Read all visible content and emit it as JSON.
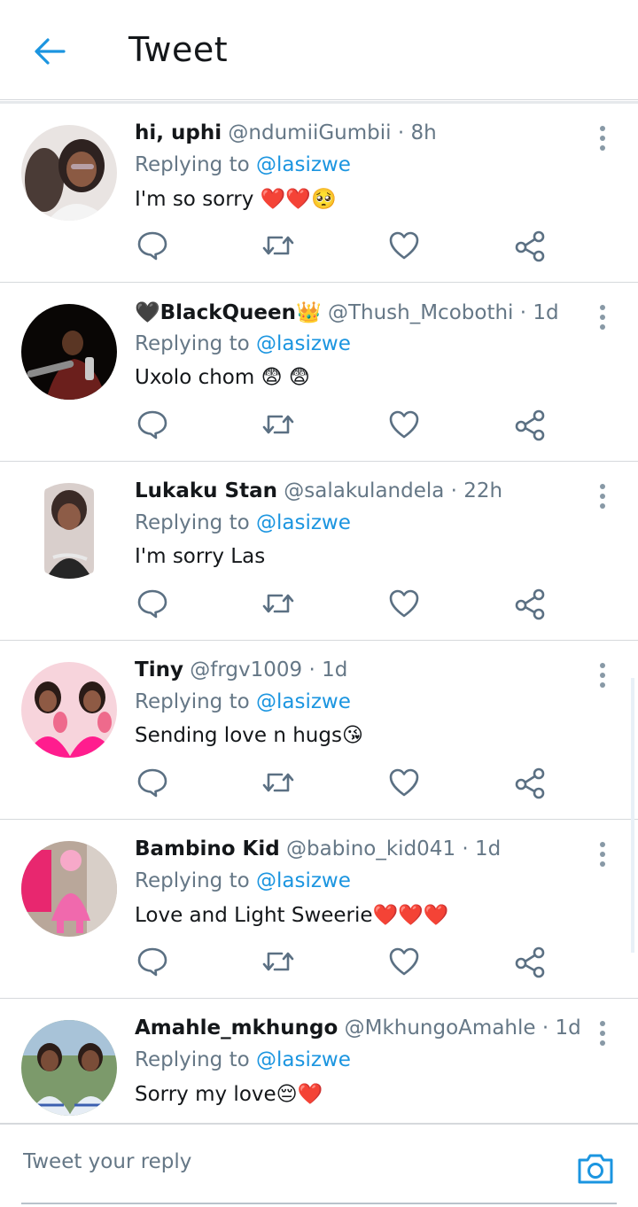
{
  "header": {
    "title": "Tweet",
    "back_icon": "arrow-left-icon"
  },
  "colors": {
    "accent": "#1b95e0",
    "text": "#14171a",
    "muted": "#657786",
    "divider": "#d6d9dc"
  },
  "tweets": [
    {
      "name": "hi, uphi",
      "handle": "@ndumiiGumbii",
      "time": "· 8h",
      "reply_prefix": "Replying to",
      "reply_user": "@lasizwe",
      "text": "I'm so sorry ❤️❤️🥺"
    },
    {
      "name": "🖤BlackQueen👑",
      "handle": "@Thush_Mcobothi",
      "time": "· 1d",
      "reply_prefix": "Replying to",
      "reply_user": "@lasizwe",
      "text": "Uxolo chom 😨 😨"
    },
    {
      "name": "Lukaku Stan",
      "handle": "@salakulandela",
      "time": "· 22h",
      "reply_prefix": "Replying to",
      "reply_user": "@lasizwe",
      "text": "I'm sorry Las"
    },
    {
      "name": "Tiny",
      "handle": "@frgv1009",
      "time": "· 1d",
      "reply_prefix": "Replying to",
      "reply_user": "@lasizwe",
      "text": "Sending love n hugs😘"
    },
    {
      "name": "Bambino Kid",
      "handle": "@babino_kid041",
      "time": "· 1d",
      "reply_prefix": "Replying to",
      "reply_user": "@lasizwe",
      "text": "Love and Light Sweerie❤️❤️❤️"
    },
    {
      "name": "Amahle_mkhungo",
      "handle": "@MkhungoAmahle",
      "time": "· 1d",
      "reply_prefix": "Replying to",
      "reply_user": "@lasizwe",
      "text": "Sorry my love😔❤️"
    }
  ],
  "composer": {
    "placeholder": "Tweet your reply",
    "camera_icon": "camera-icon"
  }
}
